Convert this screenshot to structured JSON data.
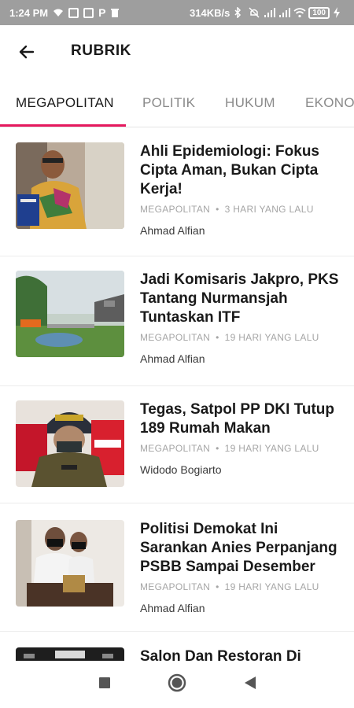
{
  "status_bar": {
    "time": "1:24 PM",
    "network_speed": "314KB/s",
    "battery": "100"
  },
  "app_bar": {
    "title": "RUBRIK",
    "back_icon": "arrow-left-icon"
  },
  "tabs": [
    {
      "label": "MEGAPOLITAN",
      "active": true
    },
    {
      "label": "POLITIK",
      "active": false
    },
    {
      "label": "HUKUM",
      "active": false
    },
    {
      "label": "EKONOMI",
      "active": false
    }
  ],
  "articles": [
    {
      "title": "Ahli Epidemiologi: Fokus Cipta Aman, Bukan Cipta Kerja!",
      "category": "MEGAPOLITAN",
      "time": "3 HARI YANG LALU",
      "author": "Ahmad Alfian"
    },
    {
      "title": "Jadi Komisaris Jakpro, PKS Tantang Nurmansjah Tuntaskan ITF",
      "category": "MEGAPOLITAN",
      "time": "19 HARI YANG LALU",
      "author": "Ahmad Alfian"
    },
    {
      "title": "Tegas, Satpol PP DKI Tutup 189 Rumah Makan",
      "category": "MEGAPOLITAN",
      "time": "19 HARI YANG LALU",
      "author": "Widodo Bogiarto"
    },
    {
      "title": "Politisi Demokat Ini Sarankan Anies Perpanjang PSBB Sampai Desember",
      "category": "MEGAPOLITAN",
      "time": "19 HARI YANG LALU",
      "author": "Ahmad Alfian"
    },
    {
      "title": "Salon Dan Restoran Di",
      "category": "",
      "time": "",
      "author": ""
    }
  ],
  "nav_bar": {
    "recents_icon": "square-icon",
    "home_icon": "circle-icon",
    "back_icon": "triangle-back-icon"
  },
  "colors": {
    "accent": "#e5195e",
    "status_bar": "#9e9e9e"
  }
}
